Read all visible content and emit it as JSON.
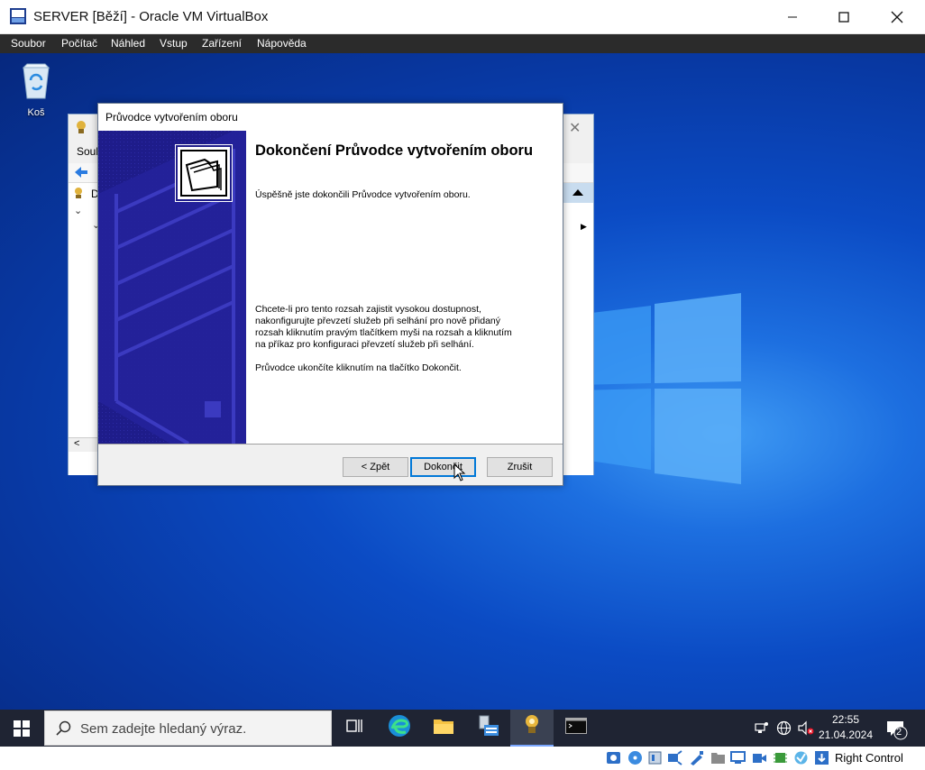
{
  "window": {
    "title": "SERVER [Běží] - Oracle VM VirtualBox",
    "icon": "virtualbox-icon"
  },
  "menu": {
    "items": [
      "Soubor",
      "Počítač",
      "Náhled",
      "Vstup",
      "Zařízení",
      "Nápověda"
    ]
  },
  "desktop": {
    "recycle_bin_label": "Koš"
  },
  "background_window": {
    "menu_fragment": "Soub",
    "tree_fragment": "D"
  },
  "wizard": {
    "title": "Průvodce vytvořením oboru",
    "heading": "Dokončení Průvodce vytvořením oboru",
    "success_text": "Úspěšně jste dokončili Průvodce vytvořením oboru.",
    "failover_text": "Chcete-li pro tento rozsah zajistit vysokou dostupnost, nakonfigurujte převzetí služeb při selhání pro nově přidaný rozsah kliknutím pravým tlačítkem myši na rozsah a kliknutím na příkaz pro konfiguraci převzetí služeb při selhání.",
    "finish_hint": "Průvodce ukončíte kliknutím na tlačítko Dokončit.",
    "buttons": {
      "back": "< Zpět",
      "finish": "Dokončit",
      "cancel": "Zrušit"
    }
  },
  "taskbar": {
    "search_placeholder": "Sem zadejte hledaný výraz.",
    "time": "22:55",
    "date": "21.04.2024",
    "notification_count": "2",
    "pinned": [
      "task-view-icon",
      "edge-icon",
      "file-explorer-icon",
      "server-manager-icon",
      "dhcp-icon",
      "cmd-icon"
    ]
  },
  "statusbar": {
    "host_key": "Right Control"
  },
  "colors": {
    "accent": "#0078d7",
    "banner": "#1e1c8a",
    "taskbar": "#1f2433",
    "desktop": "#0b4bc4"
  }
}
